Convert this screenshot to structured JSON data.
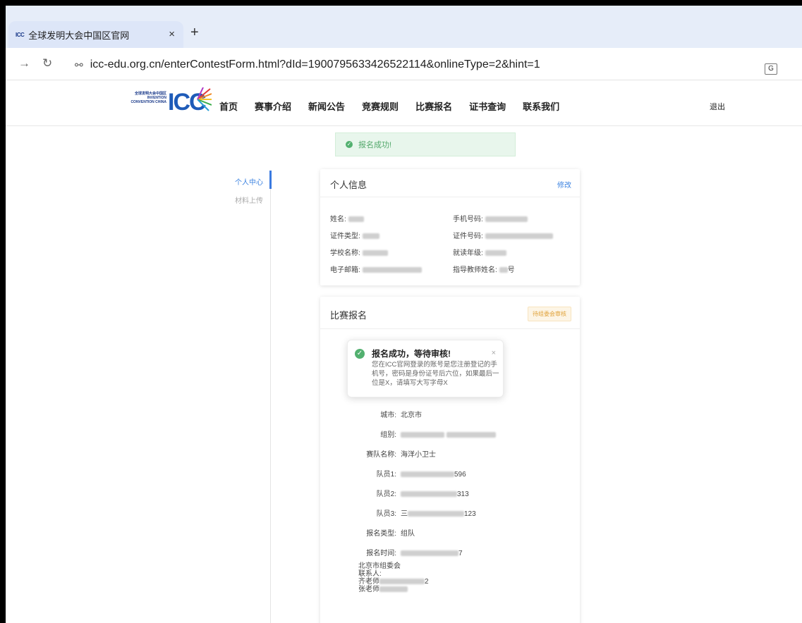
{
  "browser": {
    "tab_title": "全球发明大会中国区官网",
    "tab_favicon": "ICC",
    "tab_close": "×",
    "new_tab": "+",
    "url": "icc-edu.org.cn/enterContestForm.html?dId=1900795633426522114&onlineType=2&hint=1"
  },
  "site": {
    "logo_small": "全球发明大会中国区 INVENTION CONVENTION CHINA",
    "logo_big": "ICC",
    "menu": [
      "首页",
      "赛事介绍",
      "新闻公告",
      "竞赛规则",
      "比赛报名",
      "证书查询",
      "联系我们"
    ],
    "logout": "退出"
  },
  "alert": {
    "text": "报名成功!"
  },
  "sidebar": {
    "items": [
      "个人中心",
      "材料上传"
    ],
    "active": "个人中心"
  },
  "personal": {
    "title": "个人信息",
    "edit": "修改",
    "fields": {
      "name": "姓名:",
      "phone": "手机号码:",
      "id_type": "证件类型:",
      "id_no": "证件号码:",
      "school": "学校名称:",
      "grade": "就读年级:",
      "email": "电子邮箱:",
      "teacher": "指导教师姓名:"
    },
    "teacher_tail": "号"
  },
  "registration": {
    "title": "比赛报名",
    "status": "待组委会审核",
    "rows": {
      "city_label": "城市:",
      "city": "北京市",
      "group_label": "组别:",
      "team_label": "赛队名称:",
      "team": "海洋小卫士",
      "m1_label": "队员1:",
      "m1_tail": "596",
      "m2_label": "队员2:",
      "m2_tail": "313",
      "m3_label": "队员3:",
      "m3_head": "三",
      "m3_tail": "123",
      "type_label": "报名类型:",
      "type": "组队",
      "time_label": "报名时间:",
      "time_tail": "7"
    },
    "contact": {
      "org": "北京市组委会",
      "label": "联系人:",
      "t1": "齐老师",
      "t1_tail": "2",
      "t2": "张老师"
    }
  },
  "notification": {
    "title": "报名成功，等待审核!",
    "body": "您在ICC官网登录的账号是您注册登记的手机号，密码是身份证号后六位，如果最后一位是X，请填写大写字母X",
    "close": "×"
  },
  "colors": {
    "accent": "#3b82e0",
    "success": "#52b06f",
    "warning": "#e0a23a"
  }
}
